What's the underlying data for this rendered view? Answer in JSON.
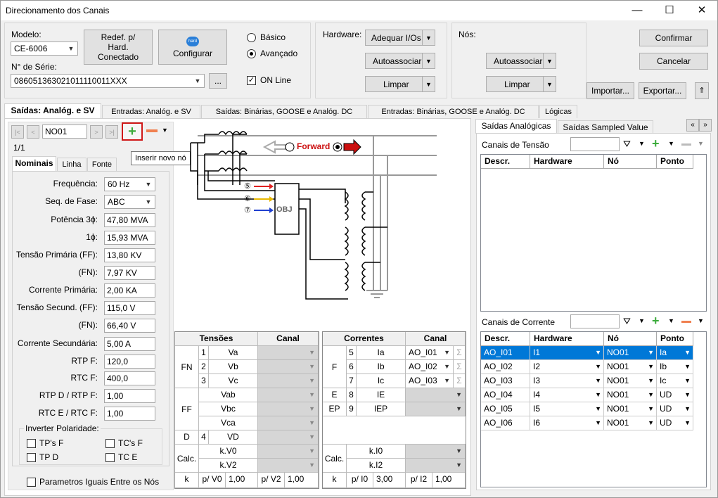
{
  "window": {
    "title": "Direcionamento dos Canais",
    "minimize": "—",
    "maximize": "☐",
    "close": "✕"
  },
  "top": {
    "modelo_label": "Modelo:",
    "modelo_value": "CE-6006",
    "serie_label": "N° de Série:",
    "serie_value": "086051363021011110011XXX",
    "serie_browse": "...",
    "redef_label": "Redef. p/ Hard. Conectado",
    "configurar_label": "Configurar",
    "hard_icon_text": "hard",
    "basico": "Básico",
    "avancado": "Avançado",
    "online": "ON Line",
    "hardware_label": "Hardware:",
    "adequar": "Adequar I/Os",
    "autoassociar": "Autoassociar",
    "limpar": "Limpar",
    "nos_label": "Nós:",
    "nos_autoassociar": "Autoassociar",
    "nos_limpar": "Limpar",
    "confirmar": "Confirmar",
    "cancelar": "Cancelar",
    "importar": "Importar...",
    "exportar": "Exportar..."
  },
  "main_tabs": [
    "Saídas: Analóg. e SV",
    "Entradas: Analóg. e SV",
    "Saídas: Binárias, GOOSE e Analóg. DC",
    "Entradas: Binárias, GOOSE e Analóg. DC",
    "Lógicas"
  ],
  "left": {
    "node_name": "NO01",
    "count": "1/1",
    "tooltip": "Inserir novo nó",
    "subtabs": [
      "Nominais",
      "Linha",
      "Fonte"
    ],
    "fields": [
      {
        "label": "Frequência:",
        "value": "60 Hz",
        "combo": true
      },
      {
        "label": "Seq. de Fase:",
        "value": "ABC",
        "combo": true
      },
      {
        "label": "Potência 3ϕ:",
        "value": "47,80 MVA"
      },
      {
        "label": "1ϕ:",
        "value": "15,93 MVA"
      },
      {
        "label": "Tensão Primária (FF):",
        "value": "13,80 KV"
      },
      {
        "label": "(FN):",
        "value": "7,97 KV"
      },
      {
        "label": "Corrente Primária:",
        "value": "2,00 KA"
      },
      {
        "label": "Tensão Secund. (FF):",
        "value": "115,0 V"
      },
      {
        "label": "(FN):",
        "value": "66,40 V"
      },
      {
        "label": "Corrente Secundária:",
        "value": "5,00 A"
      },
      {
        "label": "RTP F:",
        "value": "120,0"
      },
      {
        "label": "RTC F:",
        "value": "400,0"
      },
      {
        "label": "RTP D / RTP F:",
        "value": "1,00"
      },
      {
        "label": "RTC E / RTC F:",
        "value": "1,00"
      }
    ],
    "inverter_label": "Inverter Polaridade:",
    "tp_f": "TP's F",
    "tc_f": "TC's F",
    "tp_d": "TP D",
    "tc_e": "TC E",
    "parametros": "Parametros Iguais Entre os Nós"
  },
  "diagram": {
    "forward": "Forward",
    "obj": "OBJ",
    "n5": "⑤",
    "n6": "⑥",
    "n7": "⑦"
  },
  "tensoes": {
    "h1": "Tensões",
    "h2": "Canal",
    "fn": "FN",
    "ff": "FF",
    "d": "D",
    "calc": "Calc.",
    "k": "k",
    "rows": [
      {
        "n": "1",
        "name": "Va"
      },
      {
        "n": "2",
        "name": "Vb"
      },
      {
        "n": "3",
        "name": "Vc"
      }
    ],
    "ff_rows": [
      "Vab",
      "Vbc",
      "Vca"
    ],
    "d_row": {
      "n": "4",
      "name": "VD"
    },
    "calc_rows": [
      "k.V0",
      "k.V2"
    ],
    "pv0_label": "p/ V0",
    "pv0": "1,00",
    "pv2_label": "p/ V2",
    "pv2": "1,00"
  },
  "correntes": {
    "h1": "Correntes",
    "h2": "Canal",
    "f": "F",
    "e": "E",
    "ep": "EP",
    "calc": "Calc.",
    "k": "k",
    "rows": [
      {
        "n": "5",
        "name": "Ia",
        "canal": "AO_I01"
      },
      {
        "n": "6",
        "name": "Ib",
        "canal": "AO_I02"
      },
      {
        "n": "7",
        "name": "Ic",
        "canal": "AO_I03"
      }
    ],
    "e_row": {
      "n": "8",
      "name": "IE"
    },
    "ep_row": {
      "n": "9",
      "name": "IEP"
    },
    "calc_rows": [
      "k.I0",
      "k.I2"
    ],
    "pi0_label": "p/ I0",
    "pi0": "3,00",
    "pi2_label": "p/ I2",
    "pi2": "1,00"
  },
  "right": {
    "tabs": [
      "Saídas Analógicas",
      "Saídas Sampled Value"
    ],
    "tensao_label": "Canais de Tensão",
    "corrente_label": "Canais de Corrente",
    "headers": [
      "Descr.",
      "Hardware",
      "Nó",
      "Ponto"
    ],
    "rows": [
      {
        "descr": "AO_I01",
        "hw": "I1",
        "no": "NO01",
        "ponto": "Ia"
      },
      {
        "descr": "AO_I02",
        "hw": "I2",
        "no": "NO01",
        "ponto": "Ib"
      },
      {
        "descr": "AO_I03",
        "hw": "I3",
        "no": "NO01",
        "ponto": "Ic"
      },
      {
        "descr": "AO_I04",
        "hw": "I4",
        "no": "NO01",
        "ponto": "UD"
      },
      {
        "descr": "AO_I05",
        "hw": "I5",
        "no": "NO01",
        "ponto": "UD"
      },
      {
        "descr": "AO_I06",
        "hw": "I6",
        "no": "NO01",
        "ponto": "UD"
      }
    ]
  }
}
